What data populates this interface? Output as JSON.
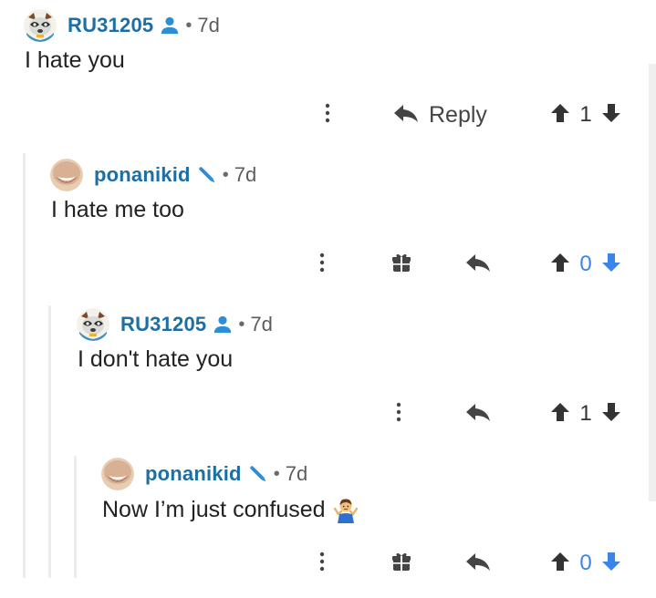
{
  "colors": {
    "username": "#1d6fa3",
    "role_icon": "#2b8fd6",
    "vote_blue": "#3a86e8",
    "action_gray": "#444444"
  },
  "comments": [
    {
      "username": "RU31205",
      "role_icon": "user-icon",
      "separator": "•",
      "time": "7d",
      "text": "I hate you",
      "reply_label": "Reply",
      "score": "1"
    },
    {
      "username": "ponanikid",
      "role_icon": "pencil-icon",
      "separator": "•",
      "time": "7d",
      "text": "I hate me too",
      "score": "0"
    },
    {
      "username": "RU31205",
      "role_icon": "user-icon",
      "separator": "•",
      "time": "7d",
      "text": "I don't hate you",
      "score": "1"
    },
    {
      "username": "ponanikid",
      "role_icon": "pencil-icon",
      "separator": "•",
      "time": "7d",
      "text": "Now I’m just confused",
      "emoji": "person-shrugging-emoji",
      "score": "0"
    }
  ]
}
